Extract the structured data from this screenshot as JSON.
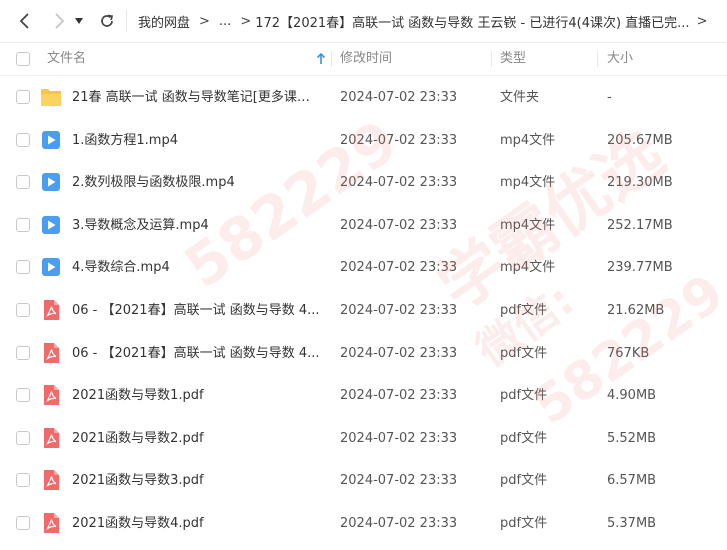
{
  "breadcrumb": {
    "root": "我的网盘",
    "ellipsis": "...",
    "current": "172【2021春】高联一试 函数与导数 王云嵚 - 已进行4(4课次) 直播已完..."
  },
  "columns": {
    "name": "文件名",
    "time": "修改时间",
    "type": "类型",
    "size": "大小"
  },
  "files": [
    {
      "icon": "folder-icon",
      "name": "21春 高联一试 函数与导数笔记[更多课程...",
      "time": "2024-07-02 23:33",
      "type": "文件夹",
      "size": "-"
    },
    {
      "icon": "video-icon",
      "name": "1.函数方程1.mp4",
      "time": "2024-07-02 23:33",
      "type": "mp4文件",
      "size": "205.67MB"
    },
    {
      "icon": "video-icon",
      "name": "2.数列极限与函数极限.mp4",
      "time": "2024-07-02 23:33",
      "type": "mp4文件",
      "size": "219.30MB"
    },
    {
      "icon": "video-icon",
      "name": "3.导数概念及运算.mp4",
      "time": "2024-07-02 23:33",
      "type": "mp4文件",
      "size": "252.17MB"
    },
    {
      "icon": "video-icon",
      "name": "4.导数综合.mp4",
      "time": "2024-07-02 23:33",
      "type": "mp4文件",
      "size": "239.77MB"
    },
    {
      "icon": "pdf-icon",
      "name": "06 - 【2021春】高联一试 函数与导数 4...",
      "time": "2024-07-02 23:33",
      "type": "pdf文件",
      "size": "21.62MB"
    },
    {
      "icon": "pdf-icon",
      "name": "06 - 【2021春】高联一试 函数与导数 4...",
      "time": "2024-07-02 23:33",
      "type": "pdf文件",
      "size": "767KB"
    },
    {
      "icon": "pdf-icon",
      "name": "2021函数与导数1.pdf",
      "time": "2024-07-02 23:33",
      "type": "pdf文件",
      "size": "4.90MB"
    },
    {
      "icon": "pdf-icon",
      "name": "2021函数与导数2.pdf",
      "time": "2024-07-02 23:33",
      "type": "pdf文件",
      "size": "5.52MB"
    },
    {
      "icon": "pdf-icon",
      "name": "2021函数与导数3.pdf",
      "time": "2024-07-02 23:33",
      "type": "pdf文件",
      "size": "6.57MB"
    },
    {
      "icon": "pdf-icon",
      "name": "2021函数与导数4.pdf",
      "time": "2024-07-02 23:33",
      "type": "pdf文件",
      "size": "5.37MB"
    }
  ],
  "watermark": {
    "line1": "学霸优选",
    "line2": "微信:",
    "line3": "582229"
  },
  "colors": {
    "folder": "#f7c54a",
    "video": "#4a9ef0",
    "pdf": "#f06a6a",
    "sort_arrow": "#3a8ee6"
  }
}
